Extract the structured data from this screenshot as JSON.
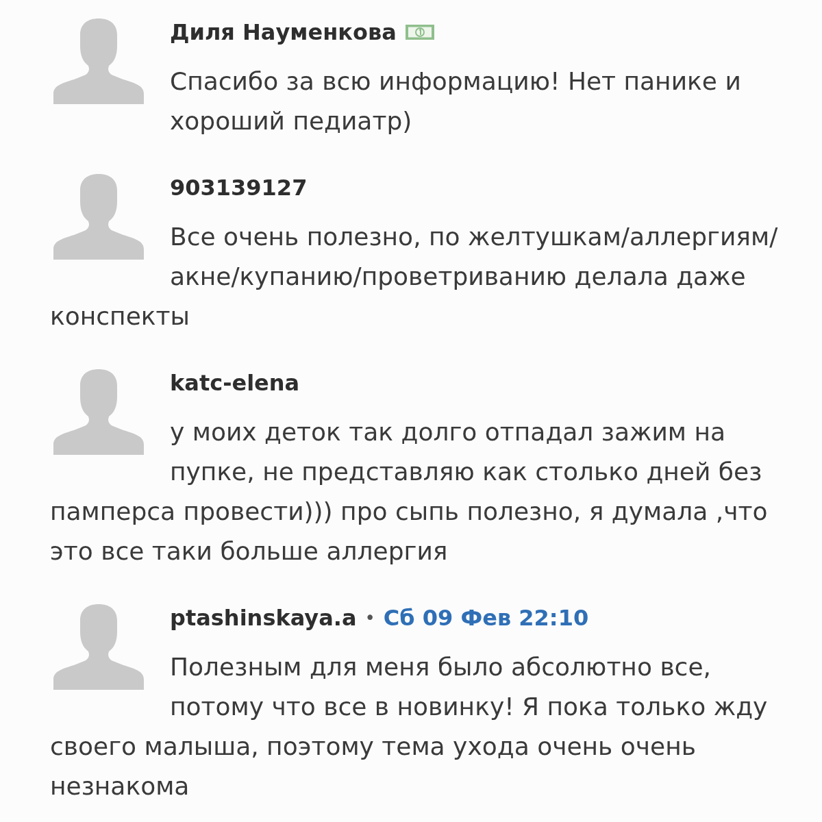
{
  "comments": [
    {
      "author": "Диля Науменкова",
      "badge": true,
      "text": "Спасибо за всю информацию! Нет панике и хороший педиатр)"
    },
    {
      "author": "903139127",
      "badge": false,
      "text": "Все очень полезно, по желтушкам/аллергиям/акне/купанию/проветриванию делала даже конспекты"
    },
    {
      "author": "katc-elena",
      "badge": false,
      "text": "у моих деток так долго отпадал зажим на пупке, не представляю как столько дней без памперса провести))) про сыпь полезно, я думала ,что это все таки больше аллергия"
    },
    {
      "author": "ptashinskaya.a",
      "badge": false,
      "separator": "•",
      "date": "Сб 09 Фев 22:10",
      "text": "Полезным для меня было абсолютно все, потому что все в новинку! Я пока только жду своего малыша, поэтому тема ухода очень очень незнакома"
    }
  ]
}
